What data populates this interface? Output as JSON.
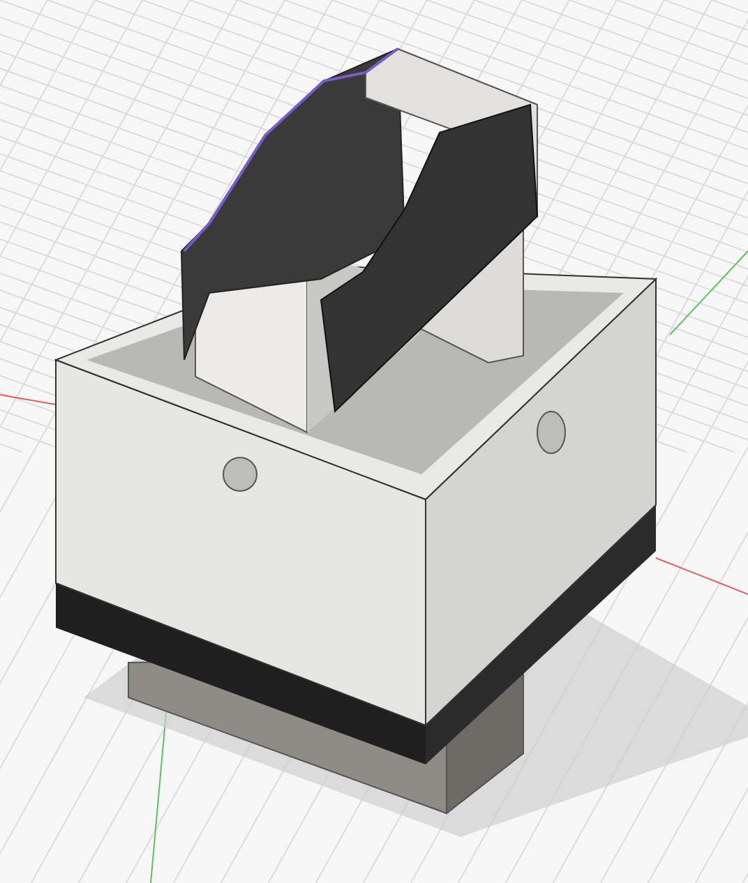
{
  "viewport": {
    "kind": "cad-model",
    "grid_visible": true
  }
}
